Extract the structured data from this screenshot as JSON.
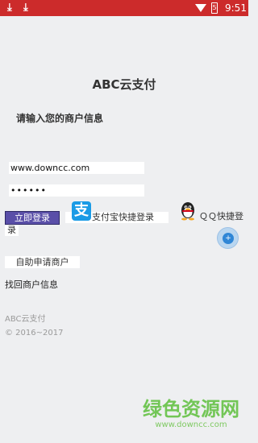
{
  "status_bar": {
    "time": "9:51",
    "battery_glyph": "5",
    "icons": [
      "download-icon",
      "download-icon",
      "wifi-icon",
      "battery-icon"
    ]
  },
  "app": {
    "title": "ABC云支付",
    "prompt": "请输入您的商户信息"
  },
  "form": {
    "username_value": "www.downcc.com",
    "password_value": "••••••"
  },
  "actions": {
    "login_label": "立即登录",
    "login_wrap": "录",
    "alipay_label": "支付宝快捷登录",
    "alipay_icon_glyph": "支",
    "qq_label": "ＱＱ快捷登",
    "apply_label": "自助申请商户",
    "retrieve_label": "找回商户信息",
    "float_glyph": "+"
  },
  "footer": {
    "name": "ABC云支付",
    "copyright": "© 2016~2017"
  },
  "watermark": {
    "main": "绿色资源网",
    "sub": "www.downcc.com"
  },
  "colors": {
    "status_bar": "#cc2b2b",
    "background": "#eeeff1",
    "login_button": "#5a4fa8",
    "alipay_blue": "#1a9be6",
    "watermark_green": "#5dbf3c"
  }
}
